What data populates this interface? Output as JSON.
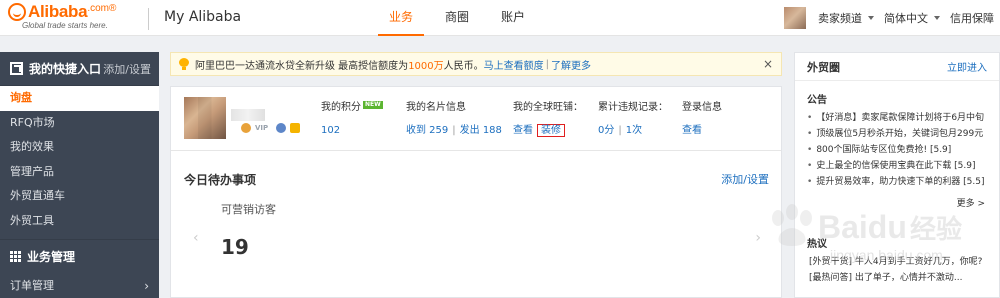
{
  "header": {
    "logo_word": "Alibaba",
    "logo_com": ".com",
    "logo_reg": "®",
    "logo_tagline": "Global trade starts here.",
    "title": "My Alibaba",
    "tabs": [
      {
        "label": "业务",
        "active": true
      },
      {
        "label": "商圈",
        "active": false
      },
      {
        "label": "账户",
        "active": false
      }
    ],
    "right_links": [
      "卖家频道",
      "简体中文",
      "信用保障"
    ]
  },
  "sidebar": {
    "quick_title": "我的快捷入口",
    "quick_add": "添加/设置",
    "items": [
      "询盘",
      "RFQ市场",
      "我的效果",
      "管理产品",
      "外贸直通车",
      "外贸工具"
    ],
    "active_index": 0,
    "section_title": "业务管理",
    "order_item": "订单管理",
    "order_arrow": "›"
  },
  "notice": {
    "text_before": "阿里巴巴一达通流水贷全新升级 最高授信额度为",
    "highlight": "1000万",
    "text_after": "人民币。",
    "link1": "马上查看额度",
    "link2": "了解更多",
    "close": "×"
  },
  "profile": {
    "vip_label": "VIP",
    "points_label": "我的积分",
    "points_new_badge": "NEW",
    "points_value": "102",
    "card_label": "我的名片信息",
    "card_received": "收到 259",
    "card_sent": "发出 188",
    "wangpu_label": "我的全球旺铺：",
    "wangpu_view": "查看",
    "wangpu_decorate": "装修",
    "violation_label": "累计违规记录：",
    "violation_score": "0分",
    "violation_times": "1次",
    "login_label": "登录信息",
    "login_view": "查看",
    "separator": "|"
  },
  "todo": {
    "title": "今日待办事项",
    "add": "添加/设置",
    "item_label": "可营销访客",
    "item_count": "19",
    "prev": "‹",
    "next": "›"
  },
  "right_panel": {
    "title": "外贸圈",
    "subscribe": "立即进入",
    "notice_title": "公告",
    "news": [
      "【好消息】卖家尾款保障计划将于6月中旬",
      "顶级展位5月秒杀开始，关键词包月299元",
      "800个国际站专区位免费抢! [5.9]",
      "史上最全的信保使用宝典在此下载 [5.9]",
      "提升贸易效率，助力快速下单的利器 [5.5]"
    ],
    "more": "更多 >",
    "hot_title": "热议",
    "hot": [
      "[外贸干货] 牛人4月到手工资好几万，你呢?",
      "[最热问答] 出了单子，心情并不激动..."
    ]
  },
  "watermark": {
    "brand": "Baidu",
    "brand_cn": "经验",
    "url": "jingyan.baidu.com"
  },
  "colors": {
    "brand_orange": "#ff6a00",
    "link_blue": "#1d6fbf",
    "sidebar_bg": "#3d4654",
    "highlight_red": "#e02020"
  }
}
